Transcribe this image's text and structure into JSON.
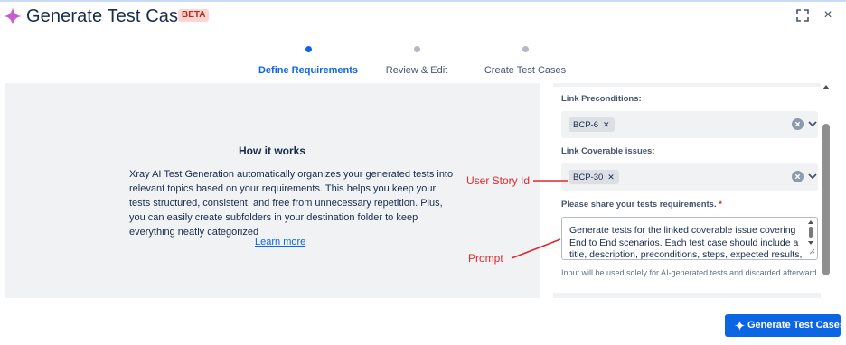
{
  "header": {
    "title": "Generate Test Cases",
    "badge": "BETA",
    "title_icon": "sparkle-icon",
    "accent_color": "#c95bd1",
    "close_label": "×"
  },
  "stepper": {
    "steps": [
      {
        "label": "Define Requirements",
        "active": true
      },
      {
        "label": "Review & Edit",
        "active": false
      },
      {
        "label": "Create Test Cases",
        "active": false
      }
    ]
  },
  "how_it_works": {
    "title": "How it works",
    "body": "Xray AI Test Generation automatically organizes your generated tests into relevant topics based on your requirements. This helps you keep your tests structured, consistent, and free from unnecessary repetition. Plus, you can easily create subfolders in your destination folder to keep everything neatly categorized",
    "link": "Learn more"
  },
  "annotations": {
    "user_story": "User Story Id",
    "prompt": "Prompt",
    "color": "#e2262a"
  },
  "form": {
    "preconditions": {
      "label": "Link Preconditions:",
      "chip": "BCP-6"
    },
    "coverable": {
      "label": "Link Coverable issues:",
      "chip": "BCP-30"
    },
    "requirements": {
      "label": "Please share your tests requirements.",
      "required_mark": "*",
      "value": "Generate tests for the linked coverable issue covering End to End scenarios. Each test case should include a title, description, preconditions, steps, expected results,",
      "helper": "Input will be used solely for AI-generated tests and discarded afterward."
    }
  },
  "footer": {
    "generate_button": "Generate Test Cases",
    "primary_color": "#0c66e4"
  }
}
